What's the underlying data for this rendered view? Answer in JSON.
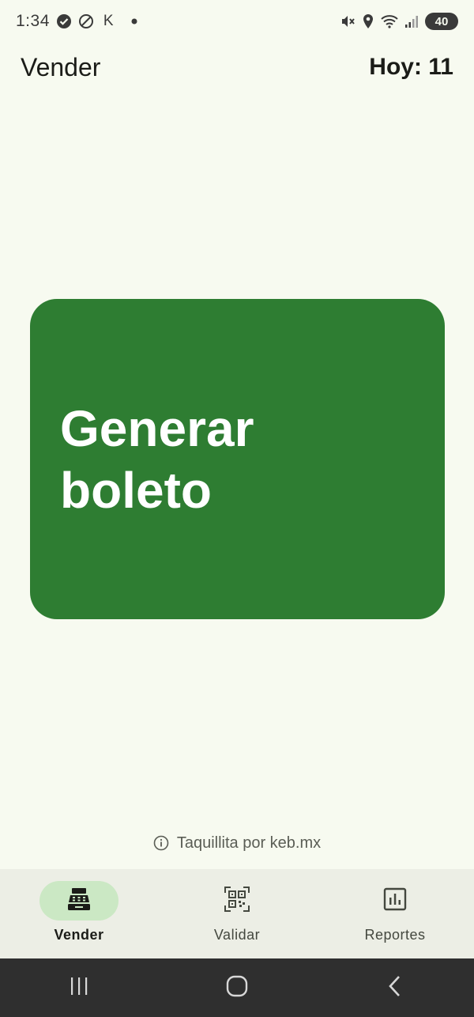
{
  "status_bar": {
    "time": "1:34",
    "k_label": "K",
    "battery": "40",
    "icons": [
      "check-circle-icon",
      "blocked-icon",
      "dot-icon",
      "mute-icon",
      "location-icon",
      "wifi-icon",
      "signal-icon"
    ]
  },
  "app_bar": {
    "title": "Vender",
    "today": "Hoy: 11"
  },
  "main": {
    "generate_label": "Generar boleto",
    "button_color": "#2e7d32"
  },
  "footer": {
    "credit": "Taquillita por keb.mx",
    "icon": "info-icon"
  },
  "bottom_nav": {
    "items": [
      {
        "label": "Vender",
        "icon": "cash-register-icon",
        "active": true
      },
      {
        "label": "Validar",
        "icon": "qr-code-icon",
        "active": false
      },
      {
        "label": "Reportes",
        "icon": "bar-chart-icon",
        "active": false
      }
    ],
    "active_color": "#cbe8c4"
  },
  "system_nav": {
    "icons": [
      "recents-icon",
      "home-icon",
      "back-icon"
    ]
  }
}
